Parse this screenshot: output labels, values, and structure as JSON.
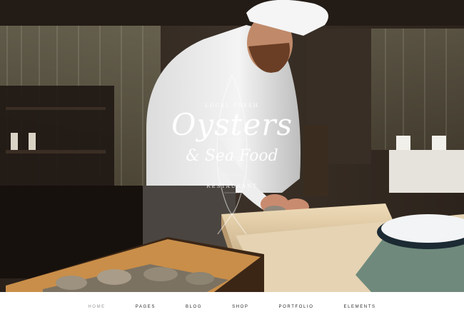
{
  "hero": {
    "logo_kicker": "LOCAL FRESH",
    "logo_main": "Oysters",
    "logo_sub": "& Sea Food",
    "logo_foot": "RESTAURANT"
  },
  "nav": {
    "items": [
      {
        "label": "HOME",
        "active": true
      },
      {
        "label": "PAGES"
      },
      {
        "label": "BLOG"
      },
      {
        "label": "SHOP"
      },
      {
        "label": "PORTFOLIO"
      },
      {
        "label": "ELEMENTS"
      }
    ]
  },
  "colors": {
    "nav_active": "#9a9a9a",
    "nav_text": "#2a2a2a",
    "hero_dark": "#1b1512"
  }
}
